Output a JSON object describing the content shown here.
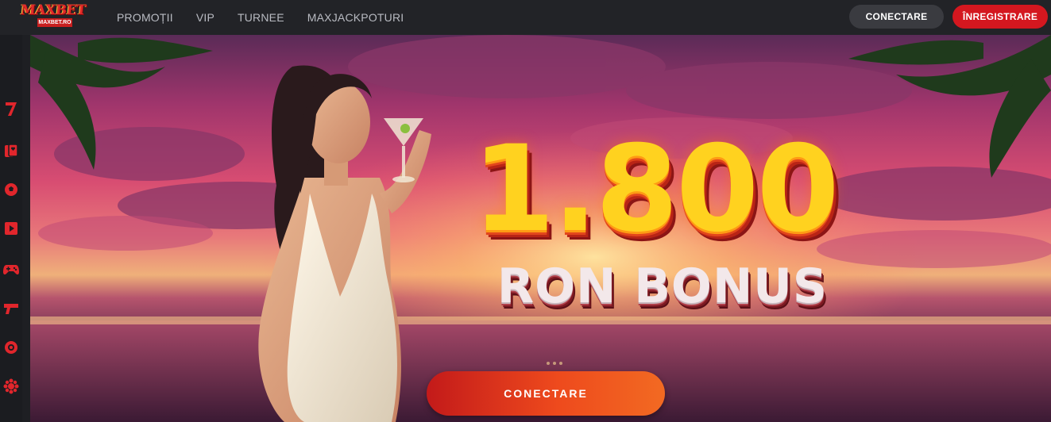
{
  "header": {
    "logo_text": "MAXBET",
    "logo_subtext": "MAXBET.RO",
    "nav": [
      "PROMOȚII",
      "VIP",
      "TURNEE",
      "MAXJACKPOTURI"
    ],
    "login_label": "CONECTARE",
    "register_label": "ÎNREGISTRARE"
  },
  "sidebar": {
    "items": [
      {
        "icon": "seven-slot-icon"
      },
      {
        "icon": "cards-icon"
      },
      {
        "icon": "football-icon"
      },
      {
        "icon": "play-video-icon"
      },
      {
        "icon": "gamepad-icon"
      },
      {
        "icon": "pistol-icon"
      },
      {
        "icon": "lottery-ball-icon"
      },
      {
        "icon": "virus-flower-icon"
      }
    ]
  },
  "hero": {
    "bonus_amount": "1.800",
    "bonus_label": "RON BONUS",
    "cta_label": "CONECTARE"
  },
  "colors": {
    "brand_red": "#d4171f",
    "topbar_bg": "#222327",
    "bonus_yellow": "#ffd21f"
  }
}
